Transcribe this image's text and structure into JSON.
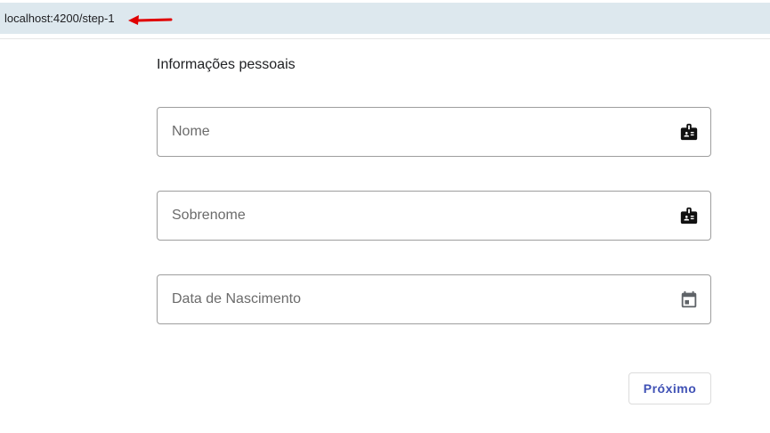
{
  "browser": {
    "url": "localhost:4200/step-1",
    "annotation_arrow_color": "#e00000"
  },
  "form": {
    "section_title": "Informações pessoais",
    "fields": [
      {
        "placeholder": "Nome",
        "value": "",
        "icon": "badge-icon"
      },
      {
        "placeholder": "Sobrenome",
        "value": "",
        "icon": "badge-icon"
      },
      {
        "placeholder": "Data de Nascimento",
        "value": "",
        "icon": "calendar-icon"
      }
    ],
    "next_label": "Próximo",
    "accent_color": "#3f51b5"
  }
}
